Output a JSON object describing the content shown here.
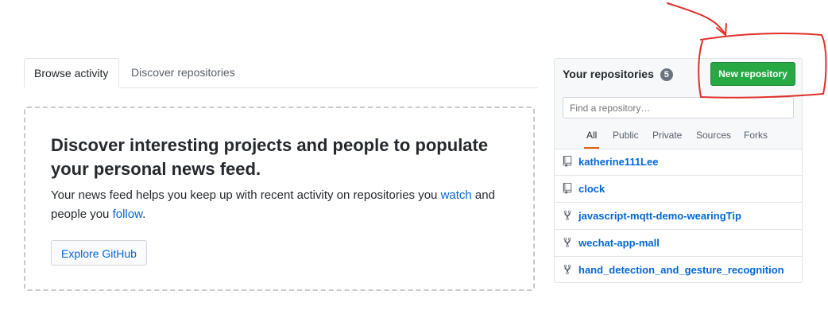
{
  "tabs": [
    {
      "label": "Browse activity",
      "active": true
    },
    {
      "label": "Discover repositories",
      "active": false
    }
  ],
  "discover": {
    "heading": "Discover interesting projects and people to populate your personal news feed.",
    "text_before_watch": "Your news feed helps you keep up with recent activity on repositories you ",
    "watch_link": "watch",
    "text_between": " and people you ",
    "follow_link": "follow",
    "text_after": ".",
    "explore_button": "Explore GitHub"
  },
  "repos_panel": {
    "title": "Your repositories",
    "count": "5",
    "new_button": "New repository",
    "search_placeholder": "Find a repository…",
    "filters": [
      "All",
      "Public",
      "Private",
      "Sources",
      "Forks"
    ],
    "active_filter": "All",
    "repositories": [
      {
        "name": "katherine111Lee",
        "icon": "repo-icon"
      },
      {
        "name": "clock",
        "icon": "repo-icon"
      },
      {
        "name": "javascript-mqtt-demo-wearingTip",
        "icon": "fork-icon"
      },
      {
        "name": "wechat-app-mall",
        "icon": "fork-icon"
      },
      {
        "name": "hand_detection_and_gesture_recognition",
        "icon": "fork-icon"
      }
    ]
  },
  "colors": {
    "accent_green": "#28a745",
    "link_blue": "#0366d6",
    "annotation_red": "#e0302a",
    "tab_underline_orange": "#e36209"
  }
}
